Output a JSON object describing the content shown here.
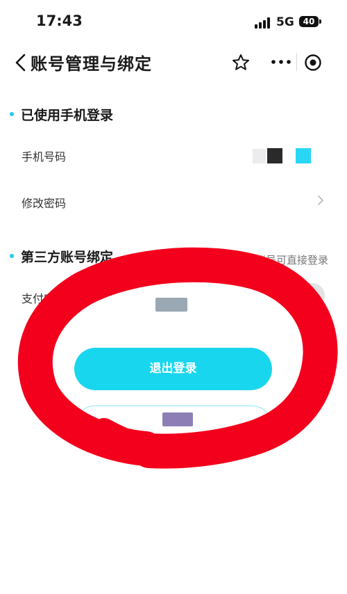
{
  "status_bar": {
    "time": "17:43",
    "network": "5G",
    "battery": "40"
  },
  "nav": {
    "title": "账号管理与绑定",
    "icons": [
      "back-icon",
      "star-icon",
      "more-icon",
      "target-icon"
    ]
  },
  "phone_section": {
    "title": "已使用手机登录",
    "phone_label": "手机号码",
    "change_password_label": "修改密码"
  },
  "third_party_section": {
    "title": "第三方账号绑定",
    "hint": "绑定第三方账号可直接登录",
    "alipay_label": "支付宝"
  },
  "actions": {
    "logout_label": "退出登录"
  },
  "colors": {
    "accent": "#18d6ee",
    "annotation": "#f2001c"
  }
}
